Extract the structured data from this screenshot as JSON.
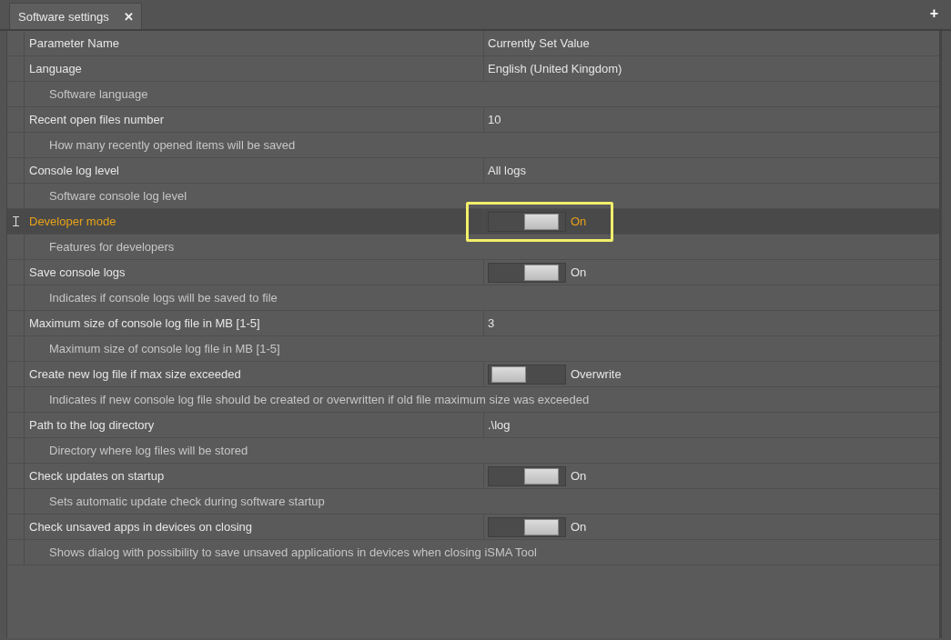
{
  "tabs": [
    {
      "label": "Software settings",
      "selected": true,
      "close": "✕"
    }
  ],
  "add_tab": "+",
  "table": {
    "columns": [
      "Parameter Name",
      "Currently Set Value"
    ],
    "rows": [
      {
        "name": "Language",
        "description": "Software language",
        "kind": "text",
        "value": "English (United Kingdom)",
        "selected": false,
        "highlighted": false
      },
      {
        "name": "Recent open files number",
        "description": "How many recently opened items will be saved",
        "kind": "text",
        "value": "10",
        "selected": false,
        "highlighted": false
      },
      {
        "name": "Console log level",
        "description": "Software console log level",
        "kind": "text",
        "value": "All logs",
        "selected": false,
        "highlighted": false
      },
      {
        "name": "Developer mode",
        "description": "Features for developers",
        "kind": "toggle",
        "on": true,
        "value": "On",
        "selected": true,
        "highlighted": true
      },
      {
        "name": "Save console logs",
        "description": "Indicates if console logs will be saved to file",
        "kind": "toggle",
        "on": true,
        "value": "On",
        "selected": false,
        "highlighted": false
      },
      {
        "name": "Maximum size of console log file in MB [1-5]",
        "description": "Maximum size of console log file in MB [1-5]",
        "kind": "text",
        "value": "3",
        "selected": false,
        "highlighted": false
      },
      {
        "name": "Create new log file if max size exceeded",
        "description": "Indicates if new console log file should be created or overwritten if old file maximum size was exceeded",
        "kind": "toggle",
        "on": false,
        "value": "Overwrite",
        "selected": false,
        "highlighted": false
      },
      {
        "name": "Path to the log directory",
        "description": "Directory where log files will be stored",
        "kind": "text",
        "value": ".\\log",
        "selected": false,
        "highlighted": false
      },
      {
        "name": "Check updates on startup",
        "description": "Sets automatic update check during software startup",
        "kind": "toggle",
        "on": true,
        "value": "On",
        "selected": false,
        "highlighted": false
      },
      {
        "name": "Check unsaved apps in devices on closing",
        "description": "Shows dialog with possibility to save unsaved applications in devices when closing iSMA Tool",
        "kind": "toggle",
        "on": true,
        "value": "On",
        "selected": false,
        "highlighted": false
      }
    ]
  }
}
